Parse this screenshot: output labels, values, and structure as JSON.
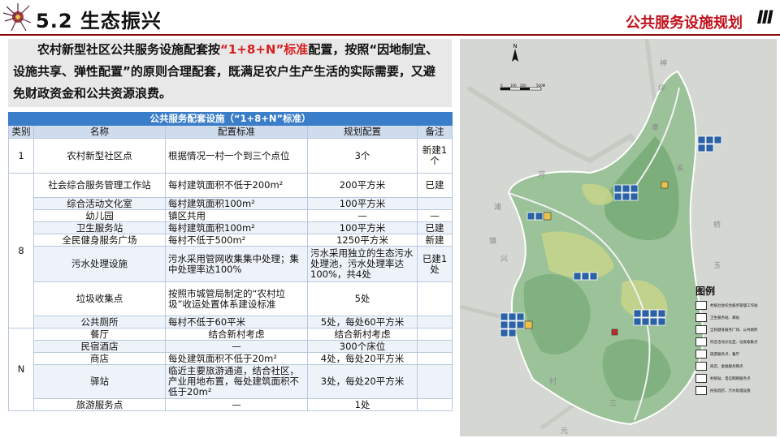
{
  "header": {
    "section_title": "5.2 生态振兴",
    "right_title": "公共服务设施规划",
    "right_marker": "III"
  },
  "intro": {
    "part1": "农村新型社区公共服务设施配套按",
    "highlight": "“1+8+N”标准",
    "part2": "配置，按照“因地制宜、设施共享、弹性配置”的原则合理配套，既满足农户生产生活的实际需要，又避免财政资金和公共资源浪费。"
  },
  "table": {
    "caption": "公共服务配套设施（“1+8+N”标准）",
    "headers": [
      "类别",
      "名称",
      "配置标准",
      "规划配置",
      "备注"
    ],
    "rows": [
      {
        "category": "1",
        "name": "农村新型社区点",
        "standard": "根据情况一村一个到三个点位",
        "plan": "3个",
        "note": "新建1个"
      },
      {
        "category": "8",
        "name": "社会综合服务管理工作站",
        "standard": "每村建筑面积不低于200m²",
        "plan": "200平方米",
        "note": "已建"
      },
      {
        "name": "综合活动文化室",
        "standard": "每村建筑面积100m²",
        "plan": "100平方米",
        "note": ""
      },
      {
        "name": "幼儿园",
        "standard": "镇区共用",
        "plan": "—",
        "note": "—"
      },
      {
        "name": "卫生服务站",
        "standard": "每村建筑面积100m²",
        "plan": "100平方米",
        "note": "已建"
      },
      {
        "name": "全民健身服务广场",
        "standard": "每村不低于500m²",
        "plan": "1250平方米",
        "note": "新建"
      },
      {
        "name": "污水处理设施",
        "standard": "污水采用管网收集集中处理；集中处理率达100%",
        "plan": "污水采用独立的生态污水处理池，污水处理率达100%，共4处",
        "note": "已建1处"
      },
      {
        "name": "垃圾收集点",
        "standard": "按照市城管局制定的“农村垃圾”收运处置体系建设标准",
        "plan": "5处",
        "note": ""
      },
      {
        "name": "公共厕所",
        "standard": "每村不低于60平米",
        "plan": "5处，每处60平方米",
        "note": ""
      },
      {
        "category": "N",
        "name": "餐厅",
        "standard": "结合新村考虑",
        "plan": "结合新村考虑",
        "note": ""
      },
      {
        "name": "民宿酒店",
        "standard": "—",
        "plan": "300个床位",
        "note": ""
      },
      {
        "name": "商店",
        "standard": "每处建筑面积不低于20m²",
        "plan": "4处，每处20平方米",
        "note": ""
      },
      {
        "name": "驿站",
        "standard": "临近主要旅游通道，结合社区，产业用地布置，每处建筑面积不低于20m²",
        "plan": "3处，每处20平方米",
        "note": ""
      },
      {
        "name": "旅游服务点",
        "standard": "—",
        "plan": "1处",
        "note": ""
      }
    ]
  },
  "map": {
    "north_label": "N",
    "scale_labels": [
      "0",
      "100",
      "200",
      "500M"
    ],
    "legend_title": "图例",
    "legend_items": [
      "村级社会综合服务管理工作站",
      "卫生服务站、驿站",
      "全民健身服务广场、公共厕所",
      "综合活动文化室、垃圾收集点",
      "旅游服务点、餐厅",
      "商店、金融服务网点",
      "村邮站、电信网络服务点",
      "民宿酒店、污水处理设施"
    ],
    "place_chars": [
      "神",
      "坪",
      "寨",
      "溪",
      "桥",
      "河",
      "滩",
      "镇",
      "兴",
      "玉",
      "村",
      "元",
      "三"
    ]
  }
}
